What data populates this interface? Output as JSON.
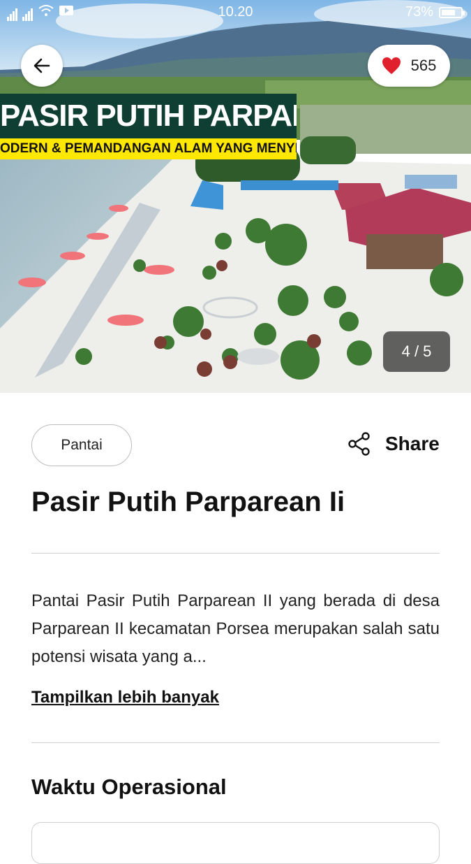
{
  "status": {
    "time": "10.20",
    "battery": "73%",
    "battery_level": 0.73
  },
  "hero": {
    "banner_title": "PASIR PUTIH PARPAREAN",
    "banner_subtitle": "ODERN & PEMANDANGAN ALAM YANG MENYEJUKKAN",
    "pager": "4 / 5",
    "like_count": "565",
    "colors": {
      "banner_bg": "#0f3f33",
      "banner_sub_bg": "#ffe800",
      "heart": "#e0202c"
    }
  },
  "category": "Pantai",
  "share_label": "Share",
  "title": "Pasir Putih Parparean Ii",
  "description": "Pantai Pasir Putih Parparean II yang berada di desa Parparean II kecamatan Porsea merupakan salah satu potensi wisata yang a...",
  "show_more": "Tampilkan lebih banyak",
  "section_title": "Waktu Operasional",
  "icons": {
    "back": "arrow-left-icon",
    "like": "heart-icon",
    "share": "share-icon"
  }
}
